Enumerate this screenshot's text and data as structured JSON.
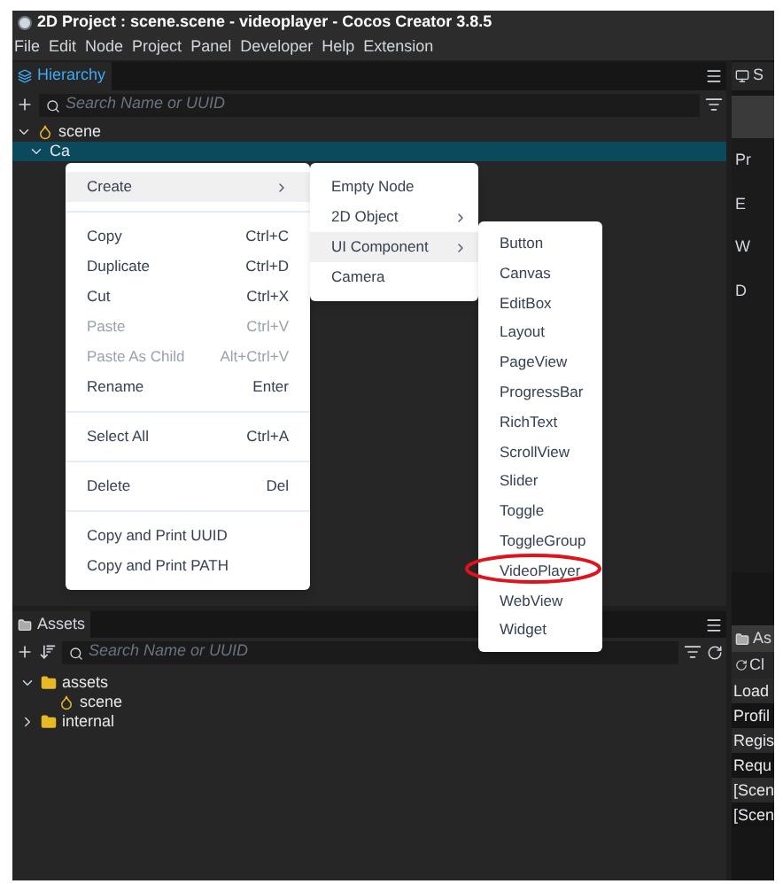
{
  "window": {
    "title": "2D Project : scene.scene - videoplayer - Cocos Creator 3.8.5"
  },
  "menu_bar": [
    "File",
    "Edit",
    "Node",
    "Project",
    "Panel",
    "Developer",
    "Help",
    "Extension"
  ],
  "hierarchy": {
    "tab": "Hierarchy",
    "search": {
      "placeholder": "Search Name or UUID"
    },
    "tree": [
      {
        "label": "scene",
        "expanded": true,
        "selected": false,
        "children": [
          {
            "label": "Ca",
            "expanded": true,
            "selected": true
          }
        ]
      }
    ]
  },
  "context_menu": [
    {
      "kind": "item",
      "label": "Create",
      "has_submenu": true,
      "selected": true,
      "disabled": false
    },
    {
      "kind": "separator"
    },
    {
      "kind": "item",
      "label": "Copy",
      "shortcut": "Ctrl+C",
      "selected": false,
      "disabled": false
    },
    {
      "kind": "item",
      "label": "Duplicate",
      "shortcut": "Ctrl+D",
      "selected": false,
      "disabled": false
    },
    {
      "kind": "item",
      "label": "Cut",
      "shortcut": "Ctrl+X",
      "selected": false,
      "disabled": false
    },
    {
      "kind": "item",
      "label": "Paste",
      "shortcut": "Ctrl+V",
      "selected": false,
      "disabled": true
    },
    {
      "kind": "item",
      "label": "Paste As Child",
      "shortcut": "Alt+Ctrl+V",
      "selected": false,
      "disabled": true
    },
    {
      "kind": "item",
      "label": "Rename",
      "shortcut": "Enter",
      "selected": false,
      "disabled": false
    },
    {
      "kind": "separator"
    },
    {
      "kind": "item",
      "label": "Select All",
      "shortcut": "Ctrl+A",
      "selected": false,
      "disabled": false
    },
    {
      "kind": "separator"
    },
    {
      "kind": "item",
      "label": "Delete",
      "shortcut": "Del",
      "selected": false,
      "disabled": false
    },
    {
      "kind": "separator"
    },
    {
      "kind": "item",
      "label": "Copy and Print UUID",
      "selected": false,
      "disabled": false
    },
    {
      "kind": "item",
      "label": "Copy and Print PATH",
      "selected": false,
      "disabled": false
    }
  ],
  "create_submenu": [
    {
      "label": "Empty Node",
      "has_submenu": false,
      "selected": false
    },
    {
      "label": "2D Object",
      "has_submenu": true,
      "selected": false
    },
    {
      "label": "UI Component",
      "has_submenu": true,
      "selected": true
    },
    {
      "label": "Camera",
      "has_submenu": false,
      "selected": false
    }
  ],
  "ui_component_submenu": [
    {
      "label": "Button",
      "circled": false
    },
    {
      "label": "Canvas",
      "circled": false
    },
    {
      "label": "EditBox",
      "circled": false
    },
    {
      "label": "Layout",
      "circled": false
    },
    {
      "label": "PageView",
      "circled": false
    },
    {
      "label": "ProgressBar",
      "circled": false
    },
    {
      "label": "RichText",
      "circled": false
    },
    {
      "label": "ScrollView",
      "circled": false
    },
    {
      "label": "Slider",
      "circled": false
    },
    {
      "label": "Toggle",
      "circled": false
    },
    {
      "label": "ToggleGroup",
      "circled": false
    },
    {
      "label": "VideoPlayer",
      "circled": true
    },
    {
      "label": "WebView",
      "circled": false
    },
    {
      "label": "Widget",
      "circled": false
    }
  ],
  "assets": {
    "tab": "Assets",
    "search": {
      "placeholder": "Search Name or UUID"
    },
    "tree": [
      {
        "label": "assets",
        "kind": "folder",
        "expanded": true,
        "children": [
          {
            "label": "scene",
            "kind": "scene"
          }
        ]
      },
      {
        "label": "internal",
        "kind": "folder",
        "expanded": false
      }
    ]
  },
  "right_top": {
    "tab": "S",
    "labels": [
      "Pr",
      "E",
      "W",
      "D"
    ]
  },
  "right_bottom": {
    "tab": "As",
    "button": "Cl",
    "rows": [
      "Load",
      "Profil",
      "Regis",
      "Requ",
      "[Scen",
      "[Scen"
    ]
  }
}
